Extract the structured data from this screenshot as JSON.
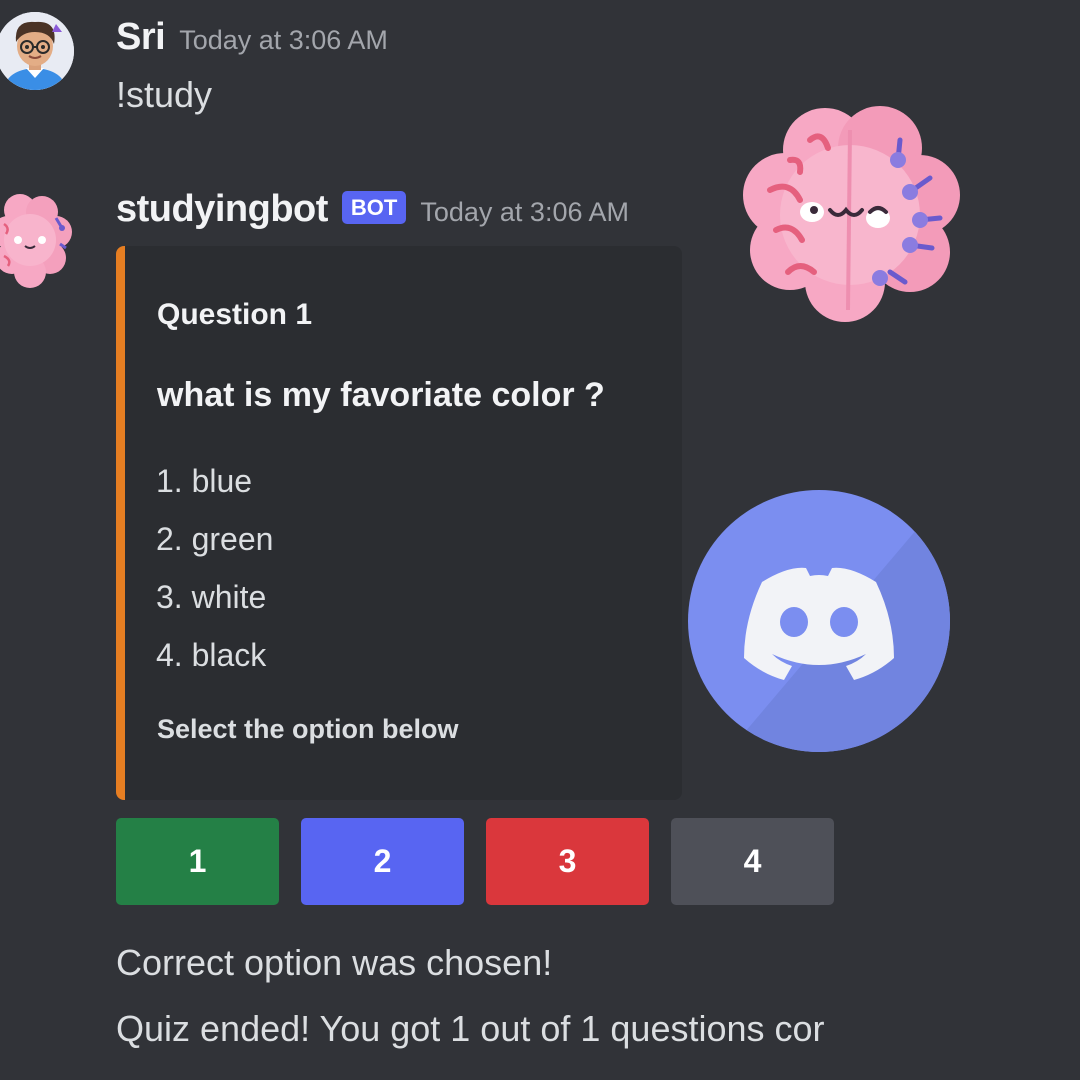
{
  "messages": {
    "user": {
      "username": "Sri",
      "timestamp": "Today at 3:06 AM",
      "text": "!study",
      "avatar_icon": "user-avatar-icon"
    },
    "bot": {
      "username": "studyingbot",
      "tag": "BOT",
      "timestamp": "Today at 3:06 AM",
      "avatar_icon": "brain-icon"
    }
  },
  "embed": {
    "accent_color": "#e67e22",
    "title": "Question 1",
    "question": "what is my favoriate color ?",
    "options": [
      "1. blue",
      "2. green",
      "3. white",
      "4. black"
    ],
    "footer": "Select the option below"
  },
  "buttons": [
    {
      "label": "1",
      "color": "#248046"
    },
    {
      "label": "2",
      "color": "#5865f2"
    },
    {
      "label": "3",
      "color": "#da373c"
    },
    {
      "label": "4",
      "color": "#4e5058"
    }
  ],
  "results": [
    "Correct option was chosen!",
    "Quiz ended! You got 1 out of 1 questions cor"
  ],
  "decorations": {
    "brain_icon": "brain-icon",
    "discord_icon": "discord-logo-icon",
    "discord_color": "#7289da"
  }
}
